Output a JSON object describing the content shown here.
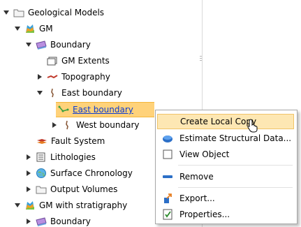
{
  "tree": {
    "items": [
      {
        "label": "Geological Models",
        "icon": "folder-icon",
        "expander": "expanded"
      },
      {
        "label": "GM",
        "icon": "geological-model-icon",
        "expander": "expanded"
      },
      {
        "label": "Boundary",
        "icon": "boundary-icon",
        "expander": "expanded"
      },
      {
        "label": "GM Extents",
        "icon": "extents-icon",
        "expander": "none"
      },
      {
        "label": "Topography",
        "icon": "topography-icon",
        "expander": "collapsed"
      },
      {
        "label": "East boundary",
        "icon": "boundary-line-icon",
        "expander": "expanded"
      },
      {
        "label": "East boundary",
        "icon": "polyline-icon",
        "expander": "none",
        "selected": true
      },
      {
        "label": "West boundary",
        "icon": "boundary-line-icon",
        "expander": "collapsed"
      },
      {
        "label": "Fault System",
        "icon": "fault-system-icon",
        "expander": "none"
      },
      {
        "label": "Lithologies",
        "icon": "lithologies-icon",
        "expander": "collapsed"
      },
      {
        "label": "Surface Chronology",
        "icon": "surface-chronology-icon",
        "expander": "collapsed"
      },
      {
        "label": "Output Volumes",
        "icon": "folder-icon",
        "expander": "collapsed"
      },
      {
        "label": "GM with stratigraphy",
        "icon": "geological-model-icon",
        "expander": "expanded"
      },
      {
        "label": "Boundary",
        "icon": "boundary-icon",
        "expander": "collapsed"
      }
    ]
  },
  "context_menu": {
    "items": [
      {
        "label": "Create Local Copy",
        "icon": "none",
        "highlighted": true
      },
      {
        "label": "Estimate Structural Data...",
        "icon": "structural-data-icon"
      },
      {
        "label": "View Object",
        "icon": "checkbox-icon",
        "checked": false
      },
      {
        "label": "Remove",
        "icon": "remove-icon"
      },
      {
        "label": "Export...",
        "icon": "export-icon"
      },
      {
        "label": "Properties...",
        "icon": "properties-icon"
      }
    ]
  },
  "colors": {
    "selection": "#ffd27a",
    "menu_highlight": "#fde7b3",
    "link": "#0a3bd1"
  }
}
